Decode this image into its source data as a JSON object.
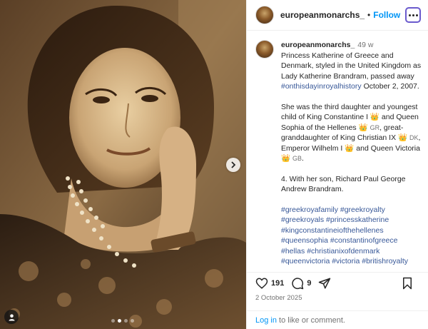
{
  "post": {
    "username": "europeanmonarchs_",
    "follow_sep": "•",
    "follow_label": "Follow",
    "age": "49 w",
    "date": "2 October 2025",
    "likes": "191",
    "comments": "9"
  },
  "caption": {
    "p1_text": "Princess Katherine of Greece and Denmark, styled in the United Kingdom as Lady Katherine Brandram, passed away ",
    "p1_tag": "#onthisdayinroyalhistory",
    "p1_end": " October 2, 2007.",
    "p2_a": "She was the third daughter and youngest child of King Constantine I ",
    "p2_b": " and Queen Sophia of the Hellenes ",
    "p2_gr": "GR",
    "p2_c": ", great-granddaughter of King Christian IX ",
    "p2_dk": "DK",
    "p2_d": ", Emperor Wilhelm I ",
    "p2_e": " and Queen Victoria ",
    "p2_gb": "GB",
    "p2_f": ".",
    "p3": "4. With her son, Richard Paul George Andrew Brandram.",
    "hashtags": "#greekroyafamily #greekroyalty #greekroyals #princesskatherine #kingconstantineiofthehellenes #queensophia #constantinofgreece #hellas #christianixofdenmark #queenvictoria #victoria #britishroyalty"
  },
  "login": {
    "link": "Log in",
    "rest": " to like or comment."
  },
  "media": {
    "dot_count": 4,
    "active_dot": 1
  },
  "icons": {
    "heart": "heart-icon",
    "comment": "comment-icon",
    "share": "share-icon",
    "save": "bookmark-icon",
    "crown": "crown-icon",
    "next": "chevron-right-icon",
    "user_tag": "user-icon"
  },
  "colors": {
    "follow": "#0095f6",
    "hashtag": "#385898",
    "sepia": "#b08a5c"
  }
}
